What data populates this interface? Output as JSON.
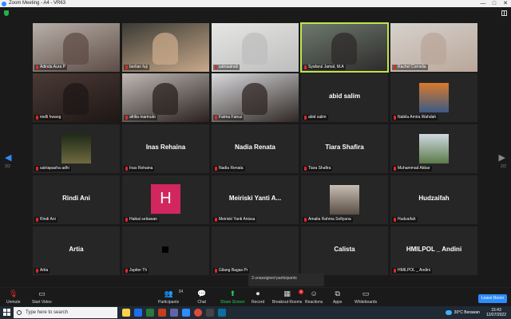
{
  "window": {
    "title": "Zoom Meeting - A4 - VR63",
    "controls": [
      "—",
      "□",
      "✕"
    ]
  },
  "pager": {
    "left_label": "2/2",
    "right_label": "2/2"
  },
  "tiles": [
    {
      "name": "Adinda Aura P",
      "type": "video",
      "colors": [
        "#b8b0a8",
        "#5d4c46"
      ]
    },
    {
      "name": "berlian fuji",
      "type": "video",
      "colors": [
        "#3a3a34",
        "#c9a98a"
      ]
    },
    {
      "name": "satriaainah",
      "type": "video",
      "colors": [
        "#e6e6e4",
        "#bdbdbd"
      ]
    },
    {
      "name": "Syafarul Jamal, M.A",
      "type": "video",
      "colors": [
        "#6d7a6e",
        "#2d2a2a"
      ],
      "active": true
    },
    {
      "name": "Rachel Cornelia",
      "type": "video",
      "colors": [
        "#d6d2cd",
        "#b9a69a"
      ]
    },
    {
      "name": "melli hwang",
      "type": "video",
      "colors": [
        "#4b3a35",
        "#1e1715"
      ]
    },
    {
      "name": "afrilia marinuto",
      "type": "video",
      "colors": [
        "#bfb8b4",
        "#2a211f"
      ]
    },
    {
      "name": "Fatma Fairuz",
      "type": "video",
      "colors": [
        "#d8d9dc",
        "#2f2724"
      ]
    },
    {
      "name": "abid salim",
      "type": "name"
    },
    {
      "name": "Nabila Amira Wahdah",
      "type": "thumb",
      "colors": [
        "#d87a2c",
        "#3b5b86"
      ]
    },
    {
      "name": "satriapasha adhi",
      "type": "thumb",
      "colors": [
        "#1f2a18",
        "#6f6a40"
      ]
    },
    {
      "name": "Inas Rehaina",
      "type": "name"
    },
    {
      "name": "Nadia Renata",
      "type": "name"
    },
    {
      "name": "Tiara Shafira",
      "type": "name"
    },
    {
      "name": "Muhammad Akbar",
      "type": "thumb",
      "colors": [
        "#cfd9e0",
        "#5b7a4a"
      ]
    },
    {
      "name": "Rindi Ani",
      "type": "name"
    },
    {
      "name": "Haikal setiawan",
      "type": "avatar",
      "initial": "H"
    },
    {
      "name": "Meiriski Yanti Anissa",
      "type": "name",
      "display": "Meiriski Yanti A..."
    },
    {
      "name": "Amalia Rahma Sofiyana",
      "type": "thumb",
      "colors": [
        "#c7bdb2",
        "#5a4f45"
      ]
    },
    {
      "name": "Hudzaifah",
      "type": "name"
    },
    {
      "name": "Artia",
      "type": "name"
    },
    {
      "name": "Jupiter Th",
      "type": "blank"
    },
    {
      "name": "Gilang Bagas Pr",
      "type": "empty"
    },
    {
      "name": "Calista",
      "type": "name-only",
      "display": "Calista"
    },
    {
      "name": "HMILPOL _ Andini",
      "type": "name"
    }
  ],
  "toast": "3 unassigned participants",
  "toolbar": {
    "unmute": "Unmute",
    "start_video": "Start Video",
    "participants": "Participants",
    "participants_count": "34",
    "chat": "Chat",
    "share_screen": "Share Screen",
    "record": "Record",
    "breakout_rooms": "Breakout Rooms",
    "breakout_badge": "5",
    "reactions": "Reactions",
    "apps": "Apps",
    "whiteboards": "Whiteboards",
    "leave": "Leave Room"
  },
  "taskbar": {
    "search_placeholder": "Type here to search",
    "weather": "30°C  Berawan",
    "time": "15:43",
    "date": "12/07/2022"
  }
}
